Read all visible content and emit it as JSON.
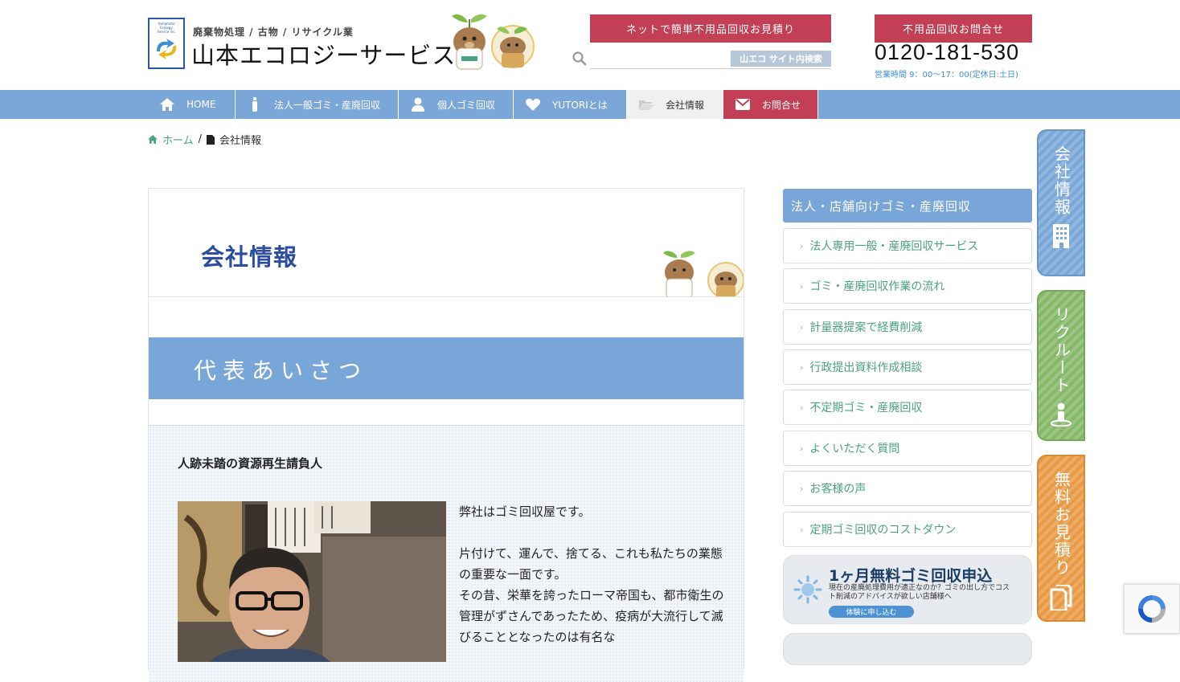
{
  "header": {
    "logo_tiny": [
      "Yamamoto",
      "Ecology",
      "Service inc."
    ],
    "tagline": "廃棄物処理 / 古物 / リサイクル業",
    "company_name": "山本エコロジーサービス",
    "estimate_button": "ネットで簡単不用品回収お見積り",
    "search_button": "山エコ サイト内検索",
    "search_placeholder": "",
    "inquiry_button": "不用品回収お問合せ",
    "phone": "0120-181-530",
    "hours": "営業時間 9：00〜17：00(定休日:土日)"
  },
  "nav": {
    "items": [
      {
        "label": "HOME",
        "icon": "home-icon"
      },
      {
        "label": "法人一般ゴミ・産廃回収",
        "icon": "bottle-icon"
      },
      {
        "label": "個人ゴミ回収",
        "icon": "person-icon"
      },
      {
        "label": "YUTORIとは",
        "icon": "heart-icon"
      },
      {
        "label": "会社情報",
        "icon": "folder-icon"
      },
      {
        "label": "お問合せ",
        "icon": "mail-icon"
      }
    ],
    "active": "会社情報"
  },
  "breadcrumb": {
    "home": "ホーム",
    "sep": "/",
    "current": "会社情報"
  },
  "main": {
    "page_title": "会社情報",
    "section_title": "代表あいさつ",
    "subheading": "人跡未踏の資源再生請負人",
    "paragraphs": [
      "弊社はゴミ回収屋です。",
      "片付けて、運んで、捨てる、これも私たちの業態の重要な一面です。",
      "その昔、栄華を誇ったローマ帝国も、都市衛生の管理がずさんであったため、疫病が大流行して滅びることとなったのは有名な"
    ]
  },
  "sidebar": {
    "heading": "法人・店舗向けゴミ・産廃回収",
    "items": [
      "法人専用一般・産廃回収サービス",
      "ゴミ・産廃回収作業の流れ",
      "計量器提案で経費削減",
      "行政提出資料作成相談",
      "不定期ゴミ・産廃回収",
      "よくいただく質問",
      "お客様の声",
      "定期ゴミ回収のコストダウン"
    ],
    "banner": {
      "title": "1ヶ月無料ゴミ回収申込",
      "text": "現在の産廃処理費用が適正なのか？ゴミの出し方でコスト削減のアドバイスが欲しい店舗様へ",
      "button": "体験に申し込む"
    }
  },
  "side_tabs": [
    {
      "label": "会社情報",
      "color": "#7aa7d8",
      "icon": "building-icon"
    },
    {
      "label": "リクルート",
      "color": "#86b86a",
      "icon": "person-info-icon"
    },
    {
      "label": "無料お見積り",
      "color": "#e89a45",
      "icon": "document-icon"
    }
  ],
  "colors": {
    "accent_red": "#c33f55",
    "nav_blue": "#7aa7d8",
    "title_blue": "#2b4ea3",
    "link_green": "#4aa37e"
  }
}
